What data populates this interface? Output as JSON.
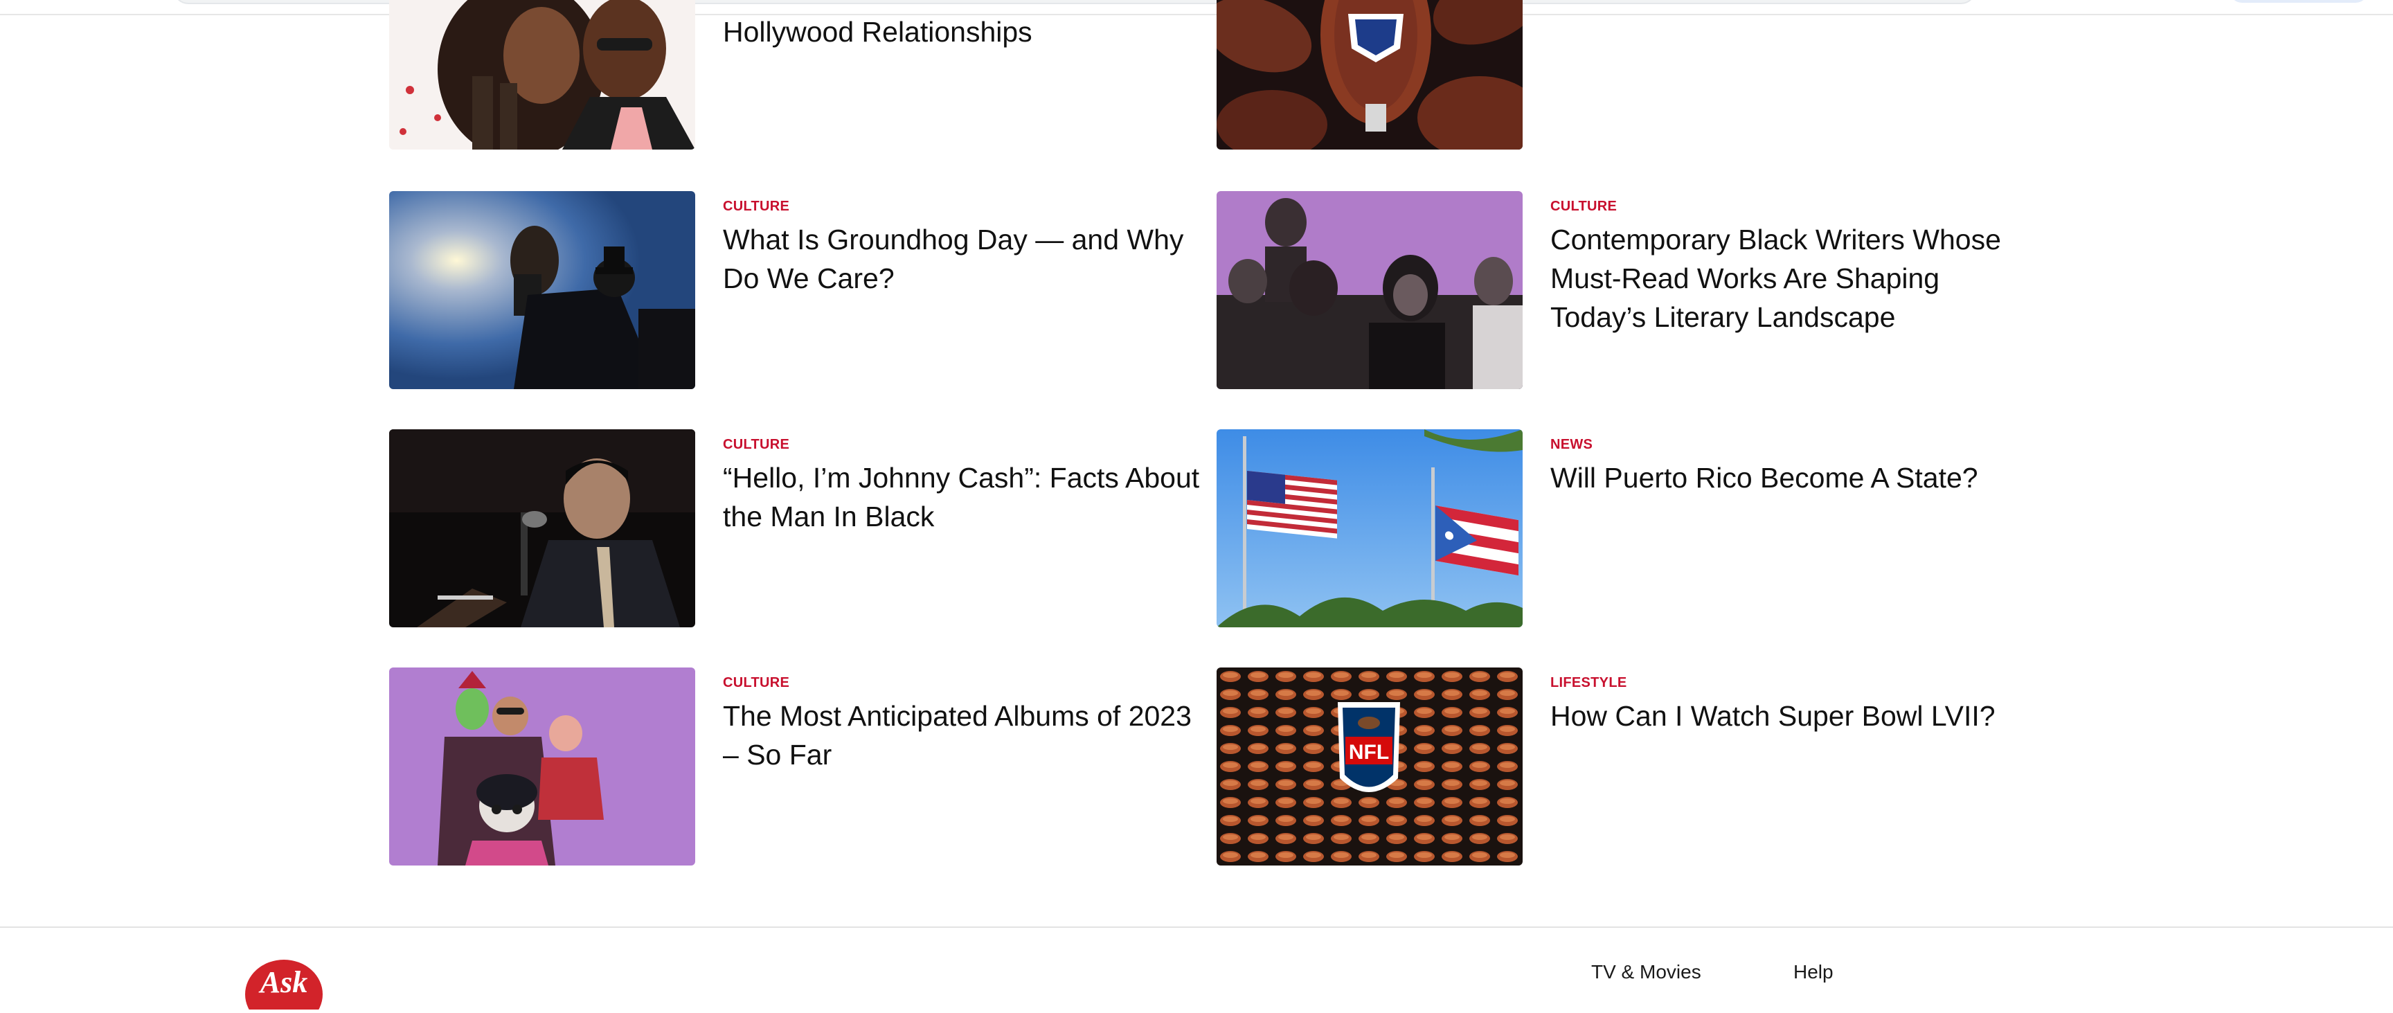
{
  "articles": [
    {
      "category": "",
      "title": "Hollywood Relationships",
      "image_icon": "couple-photo"
    },
    {
      "category": "",
      "title": "",
      "image_icon": "nfl-footballs-photo"
    },
    {
      "category": "CULTURE",
      "title": "What Is Groundhog Day — and Why Do We Care?",
      "image_icon": "groundhog-photo"
    },
    {
      "category": "CULTURE",
      "title": "Contemporary Black Writers Whose Must-Read Works Are Shaping Today’s Literary Landscape",
      "image_icon": "writers-portrait-photo"
    },
    {
      "category": "CULTURE",
      "title": "“Hello, I’m Johnny Cash”: Facts About the Man In Black",
      "image_icon": "johnny-cash-photo"
    },
    {
      "category": "NEWS",
      "title": "Will Puerto Rico Become A State?",
      "image_icon": "flags-photo"
    },
    {
      "category": "CULTURE",
      "title": "The Most Anticipated Albums of 2023 – So Far",
      "image_icon": "gorillaz-illustration"
    },
    {
      "category": "LIFESTYLE",
      "title": "How Can I Watch Super Bowl LVII?",
      "image_icon": "nfl-logo-wall-photo"
    }
  ],
  "footer": {
    "logo_text": "Ask",
    "links": [
      "TV & Movies",
      "Help"
    ]
  },
  "colors": {
    "category": "#c8102e",
    "logo": "#d2232a",
    "title": "#111111"
  }
}
